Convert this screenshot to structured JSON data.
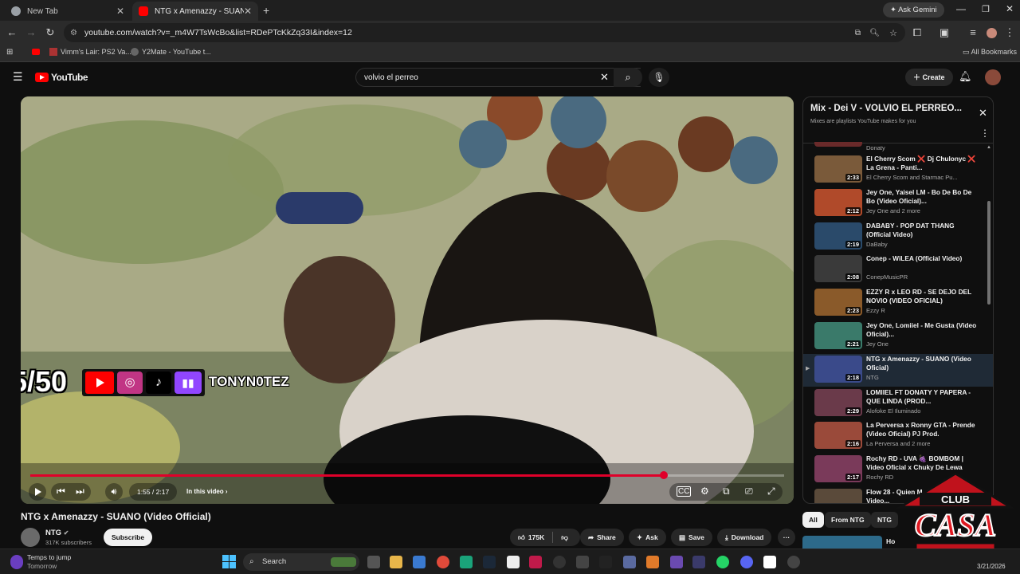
{
  "browser": {
    "tabs": [
      {
        "label": "New Tab",
        "active": false
      },
      {
        "label": "NTG x Amenazzy - SUANO (Vid",
        "active": true
      }
    ],
    "ask_gemini": "Ask Gemini",
    "url": "youtube.com/watch?v=_m4W7TsWcBo&list=RDePTcKkZq33I&index=12",
    "bookmarks": [
      {
        "label": "Vimm's Lair: PS2 Va..."
      },
      {
        "label": "Y2Mate - YouTube t..."
      }
    ],
    "all_bookmarks": "All Bookmarks"
  },
  "youtube": {
    "logo": "YouTube",
    "search_value": "volvio el perreo",
    "create_label": "Create"
  },
  "player": {
    "time": "1:55 / 2:17",
    "chapters": "In this video ›",
    "progress_fraction": 0.84,
    "overlay_counter": "5/50",
    "overlay_handle": "TONYN0TEZ"
  },
  "video_info": {
    "title": "NTG x Amenazzy - SUANO (Video Official)",
    "channel": "NTG",
    "subscribers": "317K subscribers",
    "subscribe": "Subscribe",
    "likes": "175K",
    "share": "Share",
    "ask": "Ask",
    "save": "Save",
    "download": "Download",
    "more": "···"
  },
  "playlist": {
    "title": "Mix - Dei V - VOLVIÓ EL PERREO...",
    "subtitle": "Mixes are playlists YouTube makes for you",
    "top_partial_channel": "Donaty",
    "items": [
      {
        "title": "El Cherry Scom ❌ Dj Chulonyc ❌ La Grena - Panti...",
        "channel": "El Cherry Scom and Starmac Pu...",
        "duration": "2:33",
        "color": "#7a5a3a"
      },
      {
        "title": "Jey One, Yaisel LM - Bo De Bo De Bo (Video Oficial)...",
        "channel": "Jey One and 2 more",
        "duration": "2:12",
        "color": "#b04a2a"
      },
      {
        "title": "DABABY - POP DAT THANG (Official Video)",
        "channel": "DaBaby",
        "duration": "2:19",
        "color": "#2a4a6a"
      },
      {
        "title": "Conep - WiLEA (Official Video)",
        "channel": "ConepMusicPR",
        "duration": "2:08",
        "color": "#3a3a3a"
      },
      {
        "title": "EZZY R x LEO RD - SE DEJO DEL NOVIO (VIDEO OFICIAL)",
        "channel": "Ezzy R",
        "duration": "2:23",
        "color": "#8a5a2a"
      },
      {
        "title": "Jey One, Lomiiel - Me Gusta (Video Oficial)...",
        "channel": "Jey One",
        "duration": "2:21",
        "color": "#3a7a6a"
      },
      {
        "title": "NTG x Amenazzy - SUANO (Video Oficial)",
        "channel": "NTG",
        "duration": "2:18",
        "color": "#3a4a8a",
        "current": true
      },
      {
        "title": "LOMIIEL FT DONATY Y PAPERA - QUE LINDA (PROD...",
        "channel": "Alofoke El Iluminado",
        "duration": "2:29",
        "color": "#6a3a4a"
      },
      {
        "title": "La Perversa x Ronny GTA - Prende (Video Oficial) PJ Prod.",
        "channel": "La Perversa and 2 more",
        "duration": "2:16",
        "color": "#9a4a3a"
      },
      {
        "title": "Rochy RD - UVA 🍇 BOMBOM | Video Oficial x Chuky De Lewa",
        "channel": "Rochy RD",
        "duration": "2:17",
        "color": "#7a3a5a"
      },
      {
        "title": "Flow 28 - Quien M... (Official Video...",
        "channel": "",
        "duration": "",
        "color": "#5a4a3a"
      }
    ]
  },
  "chips": [
    "All",
    "From NTG",
    "NTG"
  ],
  "bottom_partial": "Ho",
  "taskbar": {
    "weather_line1": "Temps to jump",
    "weather_line2": "Tomorrow",
    "search": "Search",
    "date": "3/21/2026"
  },
  "watermark": "CLUB CASA",
  "colors": {
    "yt_red": "#ff0000",
    "progress_red": "#e0002a",
    "bg": "#0f0f0f"
  }
}
